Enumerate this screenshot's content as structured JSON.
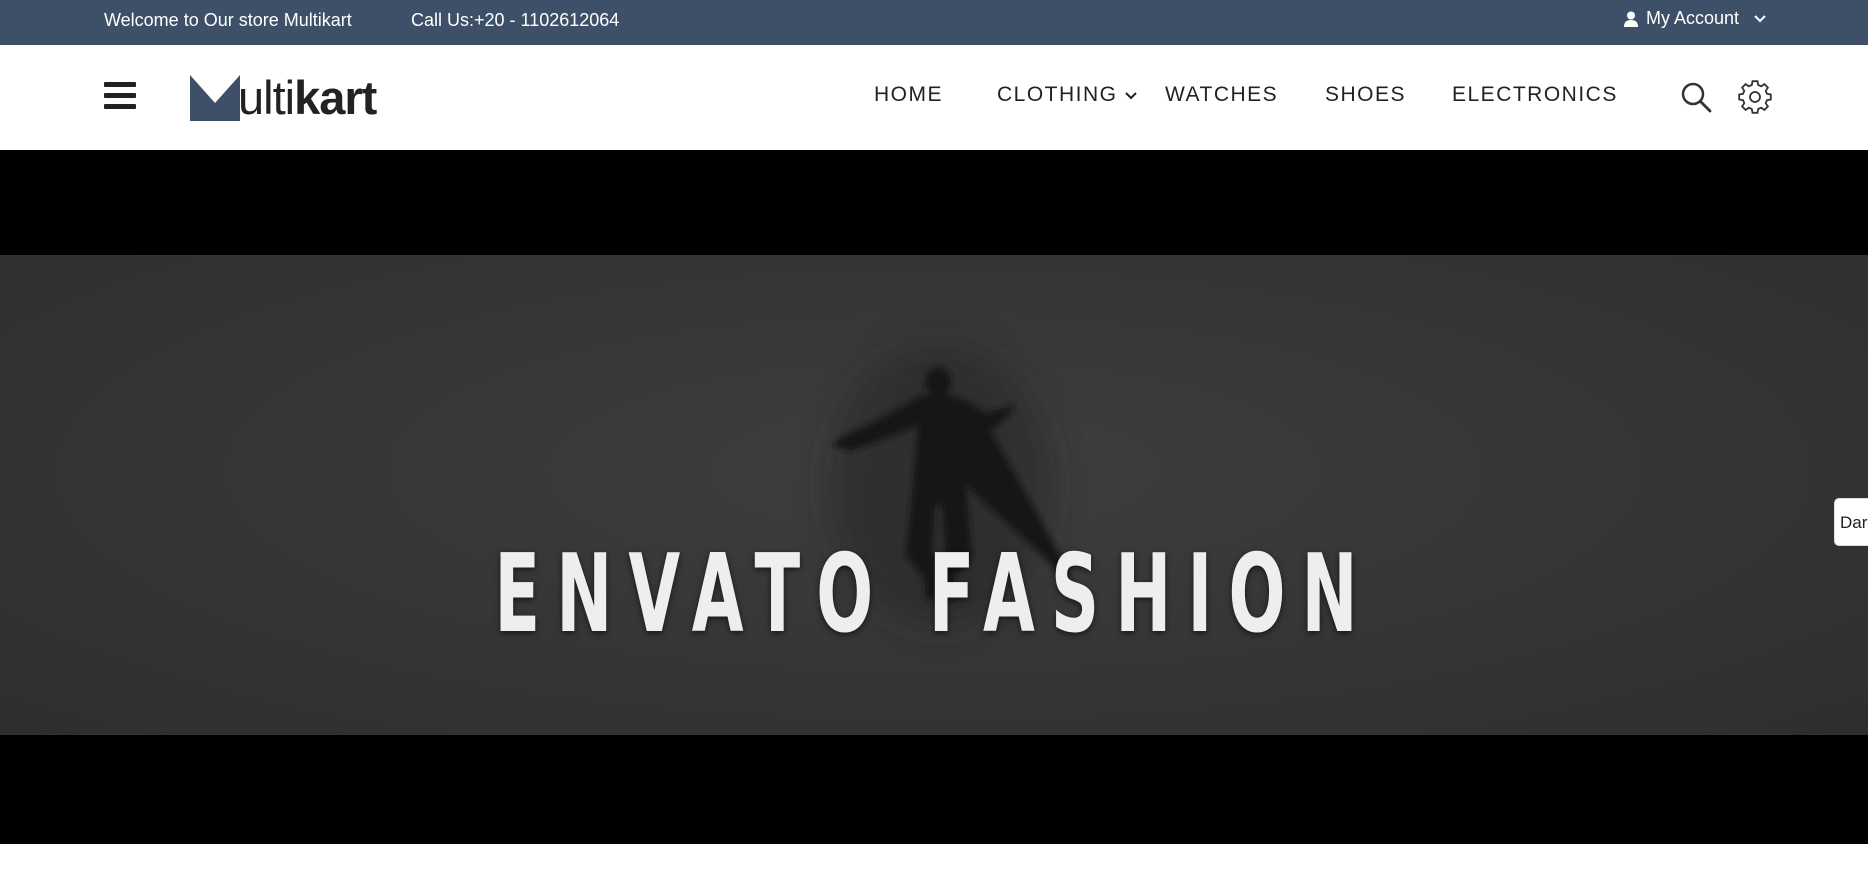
{
  "topbar": {
    "welcome_text": "Welcome to Our store Multikart",
    "phone_text": "Call Us:+20 - 1102612064",
    "account_label": "My Account",
    "background": "#3d5067"
  },
  "header": {
    "menu_icon": "hamburger-icon",
    "logo": {
      "text_light": "ulti",
      "text_bold": "kart",
      "mark_color": "#3d5067"
    },
    "nav": [
      {
        "label": "HOME"
      },
      {
        "label": "CLOTHING",
        "has_dropdown": true
      },
      {
        "label": "WATCHES"
      },
      {
        "label": "SHOES"
      },
      {
        "label": "ELECTRONICS"
      }
    ],
    "icons": [
      "search-icon",
      "gear-icon"
    ]
  },
  "hero": {
    "title": "ENVATO FASHION"
  },
  "side_tab": {
    "label": "Dark"
  }
}
